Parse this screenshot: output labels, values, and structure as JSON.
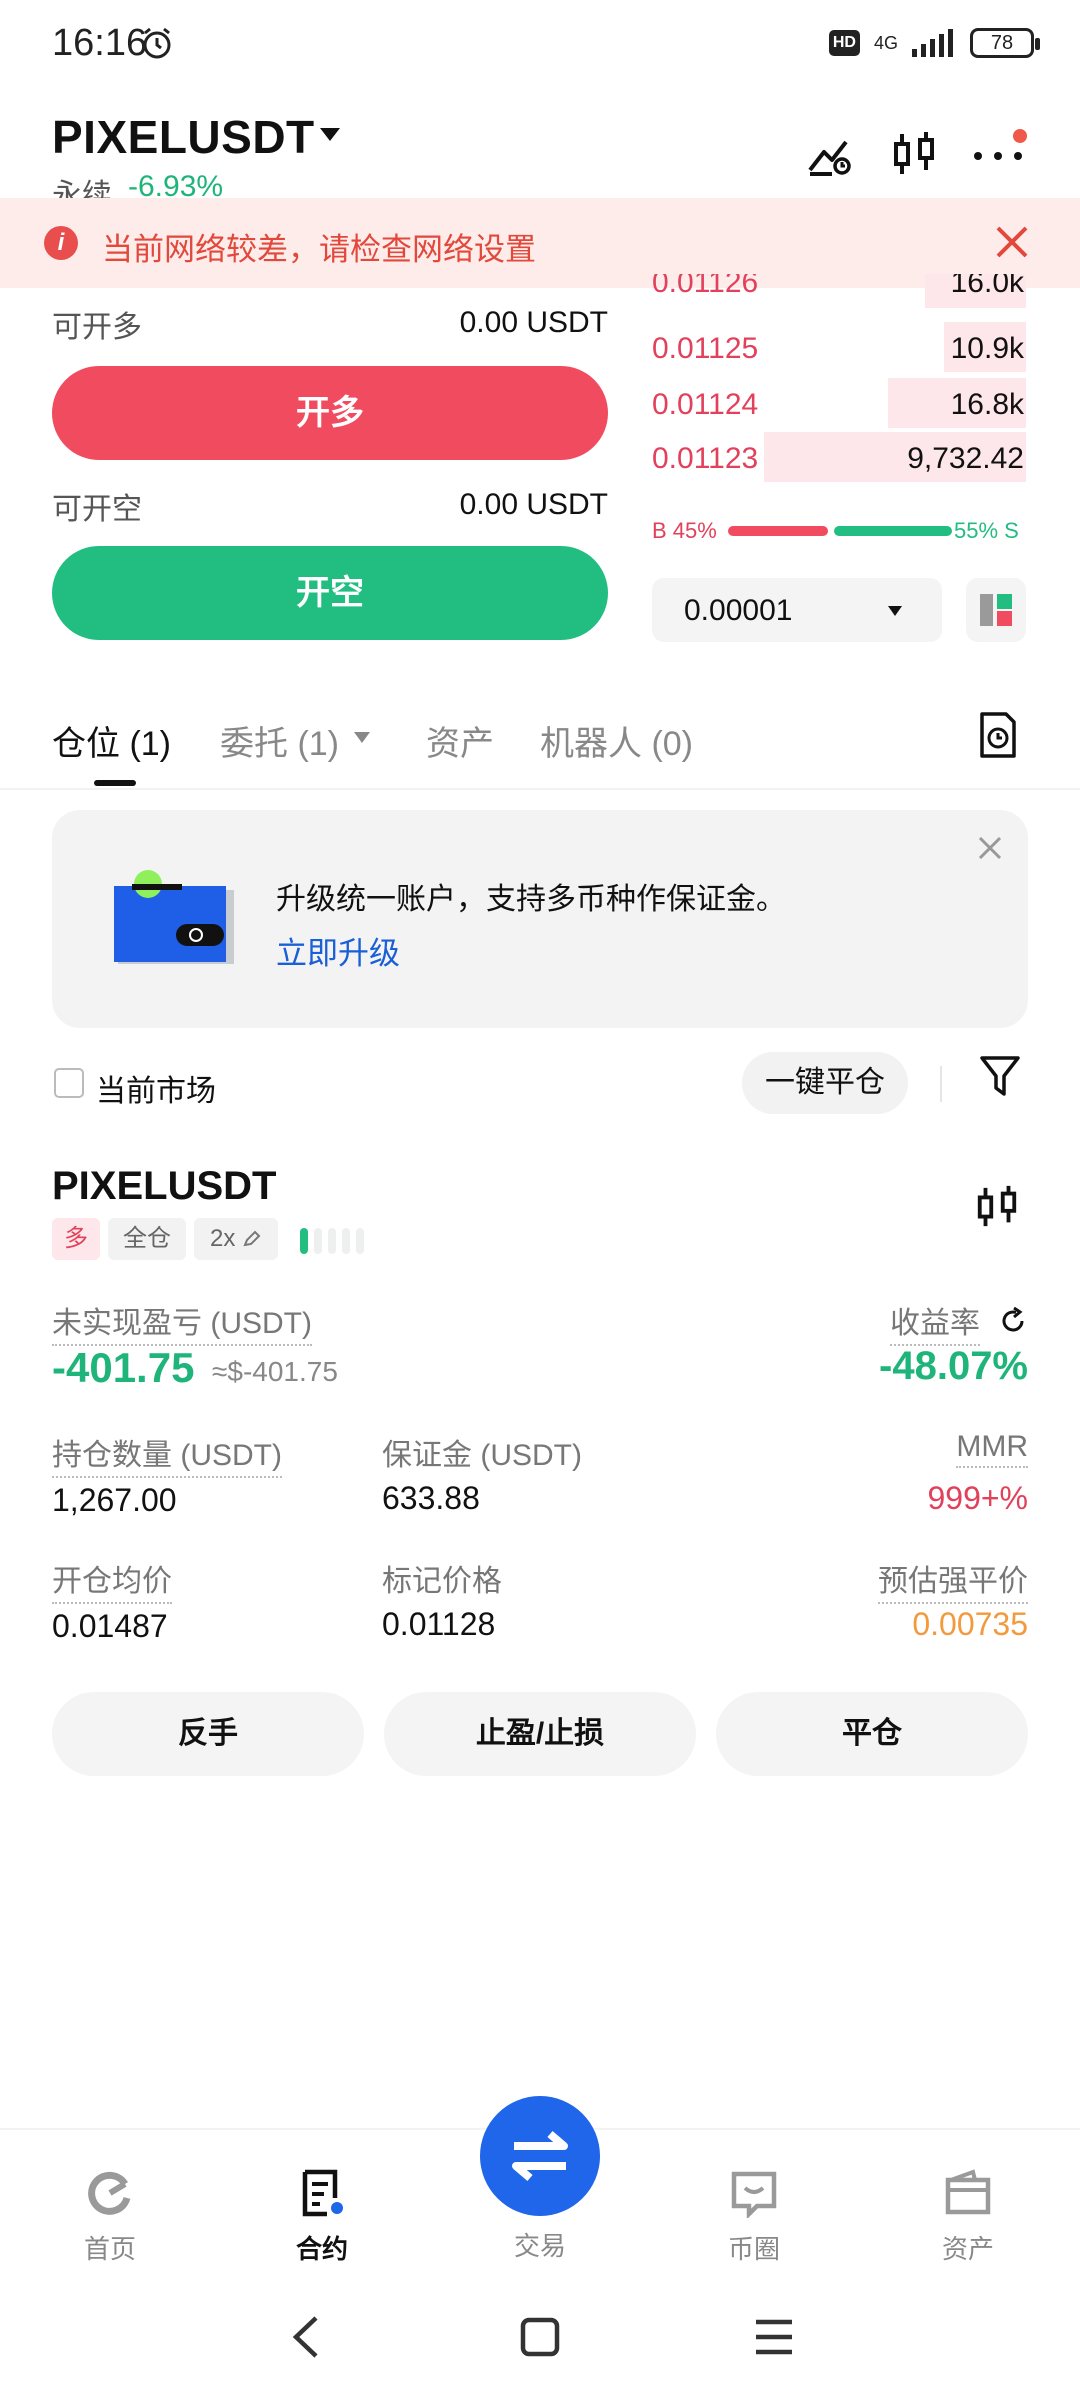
{
  "status_bar": {
    "time": "16:16",
    "hd": "HD",
    "network": "4G",
    "battery": "78"
  },
  "header": {
    "pair": "PIXELUSDT",
    "type": "永续",
    "change": "-6.93%"
  },
  "alert": {
    "icon": "i",
    "text": "当前网络较差，请检查网络设置"
  },
  "trade_panel": {
    "long_available_label": "可开多",
    "long_available_value": "0.00 USDT",
    "long_button": "开多",
    "short_available_label": "可开空",
    "short_available_value": "0.00 USDT",
    "short_button": "开空"
  },
  "order_book": {
    "rows": [
      {
        "price": "0.01126",
        "qty": "16.0k",
        "depth": 0.27
      },
      {
        "price": "0.01125",
        "qty": "10.9k",
        "depth": 0.22
      },
      {
        "price": "0.01124",
        "qty": "16.8k",
        "depth": 0.37
      },
      {
        "price": "0.01123",
        "qty": "9,732.42",
        "depth": 0.7
      }
    ],
    "buy_ratio": "B 45%",
    "sell_ratio": "55% S",
    "tick_size": "0.00001"
  },
  "tabs": [
    {
      "label": "仓位 (1)",
      "active": true
    },
    {
      "label": "委托 (1)",
      "active": false
    },
    {
      "label": "资产",
      "active": false
    },
    {
      "label": "机器人 (0)",
      "active": false
    }
  ],
  "promo": {
    "text": "升级统一账户，支持多币种作保证金。",
    "link": "立即升级"
  },
  "filter": {
    "current_market": "当前市场",
    "close_all": "一键平仓"
  },
  "position": {
    "symbol": "PIXELUSDT",
    "side": "多",
    "margin_mode": "全仓",
    "leverage": "2x",
    "unrealized_pnl_label": "未实现盈亏 (USDT)",
    "unrealized_pnl": "-401.75",
    "unrealized_pnl_usd": "≈$-401.75",
    "roe_label": "收益率",
    "roe": "-48.07%",
    "size_label": "持仓数量 (USDT)",
    "size": "1,267.00",
    "margin_label": "保证金 (USDT)",
    "margin": "633.88",
    "mmr_label": "MMR",
    "mmr": "999+%",
    "entry_label": "开仓均价",
    "entry": "0.01487",
    "mark_label": "标记价格",
    "mark": "0.01128",
    "liq_label": "预估强平价",
    "liq": "0.00735",
    "actions": [
      "反手",
      "止盈/止损",
      "平仓"
    ]
  },
  "bottom_nav": [
    {
      "label": "首页",
      "icon": "home-icon"
    },
    {
      "label": "合约",
      "icon": "contract-icon",
      "active": true
    },
    {
      "label": "交易",
      "icon": "swap-icon"
    },
    {
      "label": "币圈",
      "icon": "chat-icon"
    },
    {
      "label": "资产",
      "icon": "wallet-icon"
    }
  ],
  "colors": {
    "long": "#f04b5f",
    "short": "#21bd81",
    "accent": "#1f66ea"
  }
}
